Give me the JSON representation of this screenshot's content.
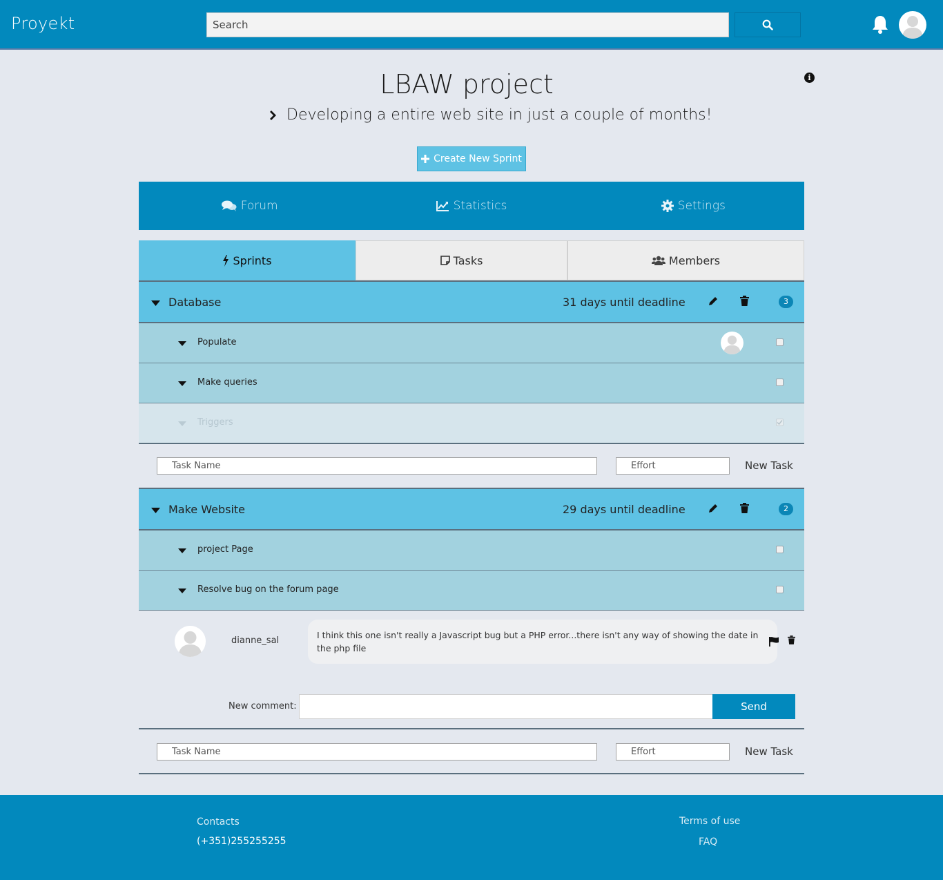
{
  "navbar": {
    "brand": "Proyekt",
    "search_placeholder": "Search"
  },
  "header": {
    "title": "LBAW project",
    "subtitle": "Developing a entire web site in just a couple of months!",
    "create_sprint_label": "Create New Sprint"
  },
  "main_tabs": [
    {
      "label": "Forum",
      "icon": "comments-icon"
    },
    {
      "label": "Statistics",
      "icon": "line-chart-icon"
    },
    {
      "label": "Settings",
      "icon": "gear-icon"
    }
  ],
  "sub_tabs": [
    {
      "label": "Sprints",
      "icon": "bolt-icon",
      "active": true
    },
    {
      "label": "Tasks",
      "icon": "sticky-note-icon",
      "active": false
    },
    {
      "label": "Members",
      "icon": "users-icon",
      "active": false
    }
  ],
  "sprints": [
    {
      "name": "Database",
      "deadline": "31 days until deadline",
      "task_count": "3",
      "tasks": [
        {
          "name": "Populate",
          "assigned": true,
          "completed": false
        },
        {
          "name": "Make queries",
          "assigned": false,
          "completed": false
        },
        {
          "name": "Triggers",
          "assigned": false,
          "completed": true
        }
      ]
    },
    {
      "name": "Make Website",
      "deadline": "29 days until deadline",
      "task_count": "2",
      "tasks": [
        {
          "name": "project Page",
          "assigned": false,
          "completed": false
        },
        {
          "name": "Resolve bug on the forum page",
          "assigned": false,
          "completed": false
        }
      ]
    }
  ],
  "comment": {
    "user": "dianne_sal",
    "text": "I think this one isn't really a Javascript bug but a PHP error...there isn't any way of showing the date in the php file"
  },
  "new_comment": {
    "label": "New comment:",
    "send_label": "Send"
  },
  "new_task": {
    "name_placeholder": "Task Name",
    "effort_placeholder": "Effort",
    "label": "New Task"
  },
  "footer": {
    "contacts_label": "Contacts",
    "phone": "(+351)255255255",
    "terms_label": "Terms of use",
    "faq_label": "FAQ"
  },
  "colors": {
    "primary": "#0289bd",
    "accent": "#5ec2e4",
    "task_row": "#a2d2df",
    "background": "#e4e8ef"
  }
}
